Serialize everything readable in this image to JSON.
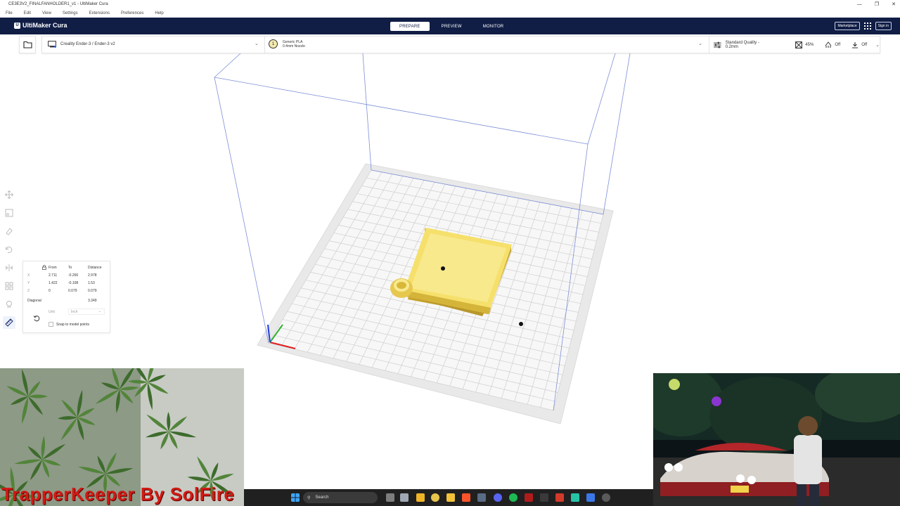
{
  "window": {
    "title": "CE3E3V2_FINALFANHOLDER1_v1 - UltiMaker Cura",
    "controls": [
      "—",
      "❐",
      "✕"
    ]
  },
  "menu": [
    "File",
    "Edit",
    "View",
    "Settings",
    "Extensions",
    "Preferences",
    "Help"
  ],
  "header": {
    "logo": "UltiMaker Cura",
    "stages": [
      "PREPARE",
      "PREVIEW",
      "MONITOR"
    ],
    "active_stage": "PREPARE",
    "marketplace": "Marketplace",
    "signin": "Sign in"
  },
  "toolbar": {
    "machine": "Creality Ender-3 / Ender-3 v2",
    "material_name": "Generic PLA",
    "nozzle": "0.4mm Nozzle",
    "extruder_number": "1",
    "quality": "Standard Quality - 0.2mm",
    "infill": "45%",
    "support": "Off",
    "adhesion": "Off"
  },
  "measure_tool": {
    "headers": {
      "from": "From",
      "to": "To",
      "distance": "Distance"
    },
    "rows": [
      {
        "axis": "X",
        "from": "2.711",
        "to": "-0.266",
        "distance": "2.978"
      },
      {
        "axis": "Y",
        "from": "1.422",
        "to": "-0.108",
        "distance": "1.53"
      },
      {
        "axis": "Z",
        "from": "0",
        "to": "0.079",
        "distance": "0.079"
      }
    ],
    "diagonal_label": "Diagonal",
    "diagonal_value": "3.349",
    "unit_label": "Unit",
    "unit_value": "Inch",
    "snap_label": "Snap to model points"
  },
  "overlay": {
    "watermark": "TrapperKeeper By SolFire"
  },
  "taskbar": {
    "search_label": "Search"
  },
  "colors": {
    "header_bg": "#101d45",
    "model_top": "#f7e170",
    "model_side": "#d9b838",
    "build_plate": "#e9e9e9",
    "build_volume_line": "#6f86d6",
    "watermark": "#d21a14"
  }
}
